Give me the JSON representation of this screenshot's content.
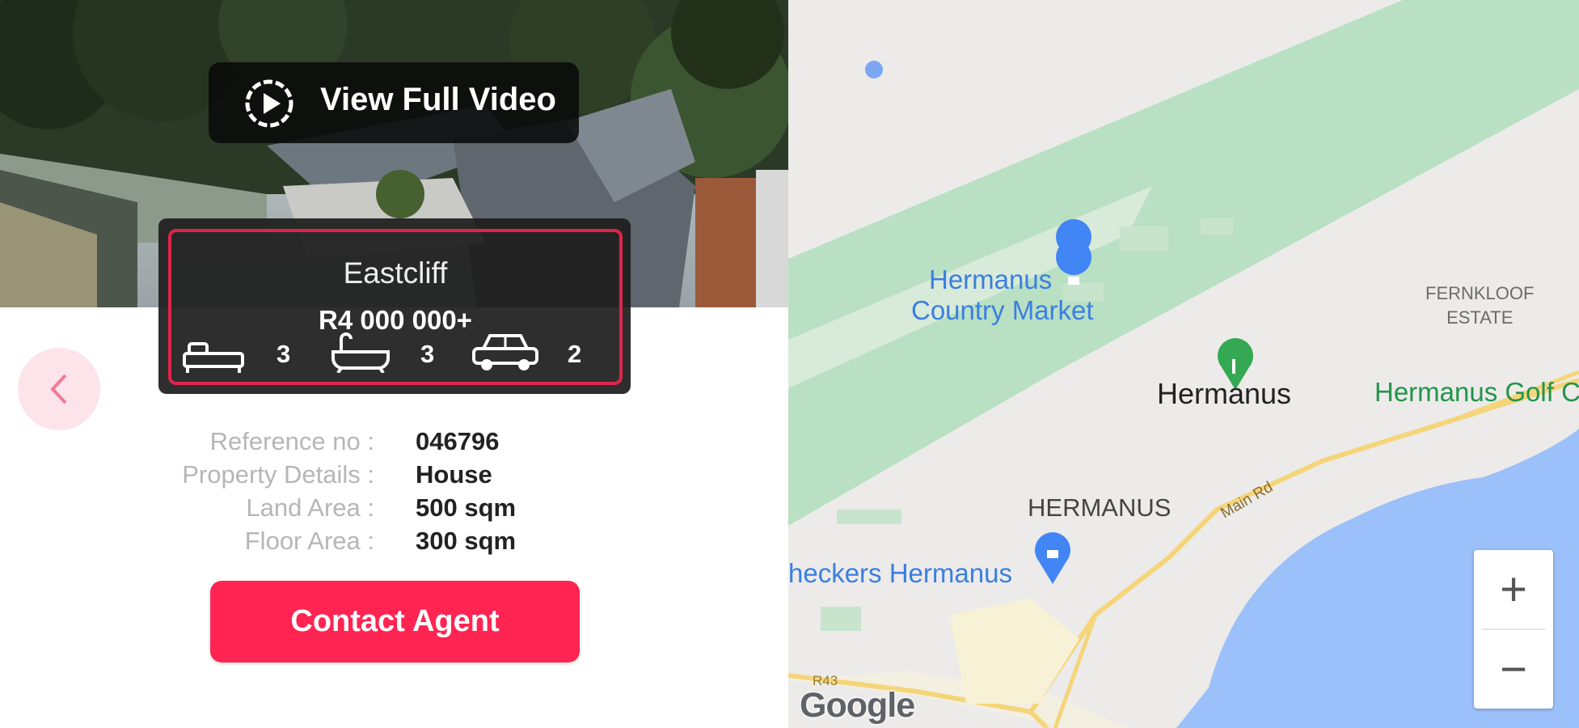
{
  "video": {
    "label": "View Full Video"
  },
  "listing": {
    "suburb": "Eastcliff",
    "price": "R4 000 000+",
    "bedrooms": "3",
    "bathrooms": "3",
    "parking": "2"
  },
  "details": [
    {
      "label": "Reference no :",
      "value": "046796"
    },
    {
      "label": "Property Details :",
      "value": "House"
    },
    {
      "label": "Land Area :",
      "value": "500 sqm"
    },
    {
      "label": "Floor Area :",
      "value": "300 sqm"
    }
  ],
  "actions": {
    "contact_label": "Contact Agent"
  },
  "map": {
    "labels": {
      "country_market_line1": "Hermanus",
      "country_market_line2": "Country Market",
      "fernkloof_line1": "FERNKLOOF",
      "fernkloof_line2": "ESTATE",
      "town": "Hermanus",
      "golf": "Hermanus Golf C",
      "town_caps": "HERMANUS",
      "main_rd": "Main Rd",
      "checkers": "heckers Hermanus",
      "r43": "R43"
    },
    "zoom_in": "+",
    "zoom_out": "−",
    "logo": "Google",
    "colors": {
      "water": "#9cc0f9",
      "park": "#b9e0c2",
      "road": "#f5d57a",
      "land": "#ecebea",
      "poi_blue": "#4285f4",
      "poi_green": "#34a853"
    }
  },
  "accent": "#ff2452"
}
